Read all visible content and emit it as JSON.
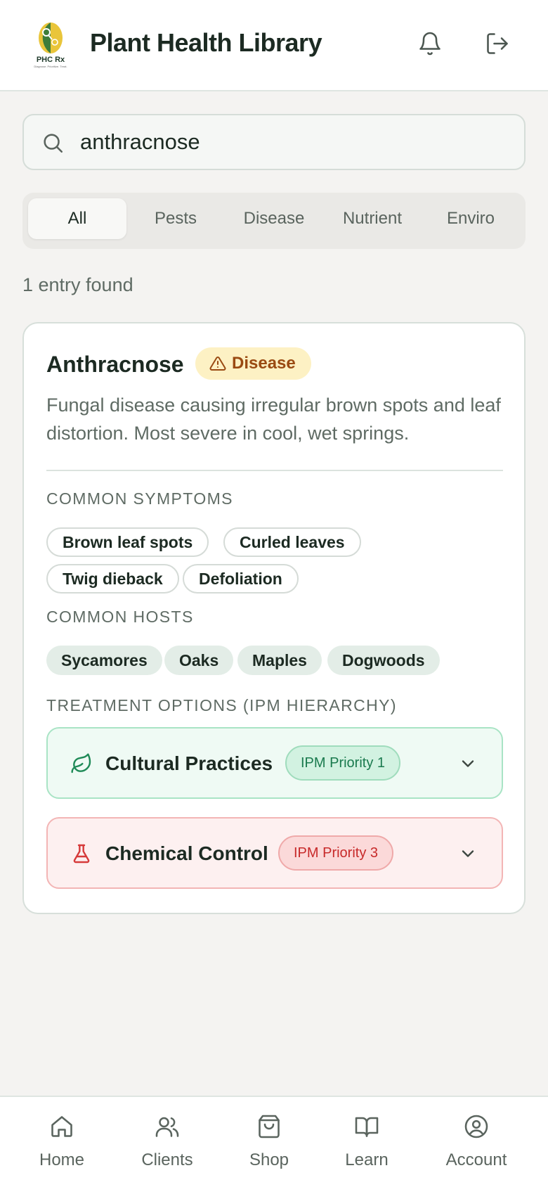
{
  "header": {
    "logo_text": "PHC Rx",
    "logo_tagline": "Diagnose. Prioritize. Treat.",
    "title": "Plant Health Library"
  },
  "search": {
    "value": "anthracnose",
    "placeholder": "Search"
  },
  "tabs": [
    {
      "label": "All",
      "active": true
    },
    {
      "label": "Pests",
      "active": false
    },
    {
      "label": "Disease",
      "active": false
    },
    {
      "label": "Nutrient",
      "active": false
    },
    {
      "label": "Enviro",
      "active": false
    }
  ],
  "results_count": "1 entry found",
  "entry": {
    "title": "Anthracnose",
    "category": "Disease",
    "description": "Fungal disease causing irregular brown spots and leaf distortion. Most severe in cool, wet springs.",
    "symptoms_label": "COMMON SYMPTOMS",
    "symptoms": [
      "Brown leaf spots",
      "Curled leaves",
      "Twig dieback",
      "Defoliation"
    ],
    "hosts_label": "COMMON HOSTS",
    "hosts": [
      "Sycamores",
      "Oaks",
      "Maples",
      "Dogwoods"
    ],
    "treatment_label": "TREATMENT OPTIONS (IPM HIERARCHY)",
    "treatments": [
      {
        "label": "Cultural Practices",
        "priority": "IPM Priority 1",
        "icon": "leaf-icon",
        "color": "#1f8a57"
      },
      {
        "label": "Chemical Control",
        "priority": "IPM Priority 3",
        "icon": "flask-icon",
        "color": "#d63a3a"
      }
    ]
  },
  "bottom_nav": [
    {
      "label": "Home",
      "icon": "home-icon"
    },
    {
      "label": "Clients",
      "icon": "users-icon"
    },
    {
      "label": "Shop",
      "icon": "shopping-bag-icon"
    },
    {
      "label": "Learn",
      "icon": "book-icon"
    },
    {
      "label": "Account",
      "icon": "account-icon"
    }
  ],
  "colors": {
    "background": "#f4f3f1",
    "accent_green": "#1f8a57",
    "disease_badge_bg": "#fdf1c4",
    "disease_badge_text": "#9a4a12",
    "danger": "#d63a3a"
  }
}
